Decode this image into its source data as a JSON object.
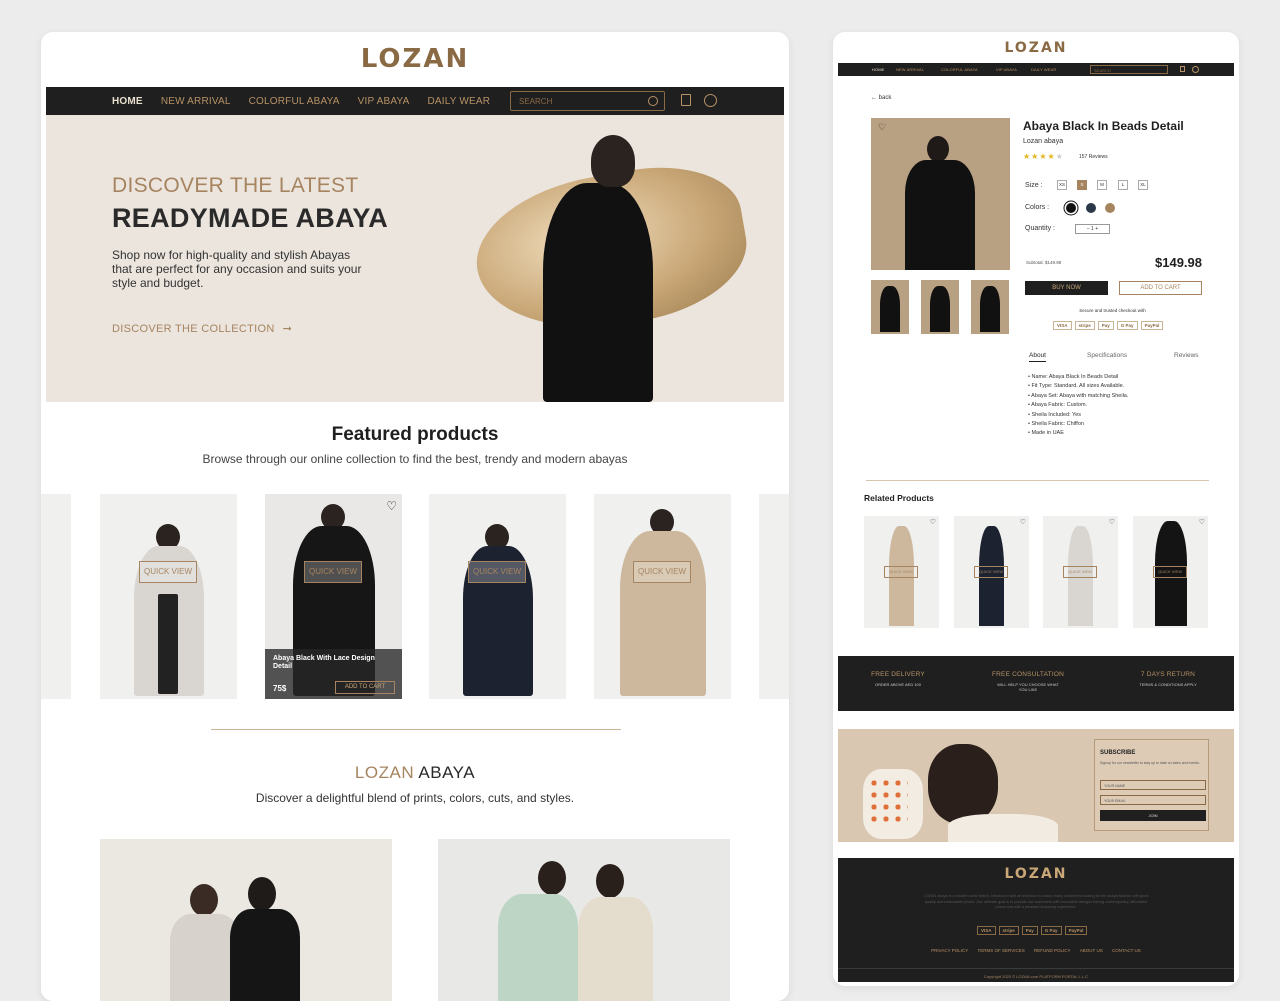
{
  "left": {
    "logo": "LOZAN",
    "nav": [
      "HOME",
      "NEW ARRIVAL",
      "COLORFUL ABAYA",
      "VIP ABAYA",
      "DAILY WEAR"
    ],
    "search_placeholder": "SEARCH",
    "hero": {
      "line1": "DISCOVER THE LATEST",
      "line2": "READYMADE ABAYA",
      "text": "Shop now for high-quality and stylish Abayas that are perfect for any occasion and suits your style and budget.",
      "cta": "DISCOVER THE COLLECTION"
    },
    "featured": {
      "title": "Featured products",
      "subtitle": "Browse through our online collection to find the best, trendy and modern abayas",
      "quick_view": "QUICK VIEW",
      "hover_product": {
        "name": "Abaya Black With Lace Design Detail",
        "price": "75$",
        "add": "ADD TO CART"
      }
    },
    "lozan_abaya": {
      "title_a": "LOZAN",
      "title_b": " ABAYA",
      "subtitle": "Discover a delightful blend of prints, colors, cuts, and styles."
    }
  },
  "right": {
    "logo": "LOZAN",
    "nav": [
      "HOME",
      "NEW ARRIVAL",
      "COLORFUL ABAYA",
      "VIP ABAYA",
      "DAILY WEAR"
    ],
    "search_placeholder": "SEARCH",
    "back": "← back",
    "product": {
      "title": "Abaya Black In Beads Detail",
      "brand": "Lozan abaya",
      "stars_filled": "★★★★",
      "stars_empty": "★",
      "reviews": "157 Reviews",
      "size_label": "Size :",
      "sizes": [
        "XS",
        "S",
        "M",
        "L",
        "XL"
      ],
      "colors_label": "Colors :",
      "colors": [
        "#111111",
        "#2c3848",
        "#a68460"
      ],
      "quantity_label": "Quantity :",
      "quantity": "–   1   +",
      "subtotal": "Subtotal: $149.98",
      "price": "$149.98",
      "buy_now": "BUY NOW",
      "add_to_cart": "ADD TO CART",
      "secure": "Secure and trusted checkout with",
      "payments": [
        "VISA",
        "stripe",
        "Pay",
        "G Pay",
        "PayPal"
      ],
      "tabs": [
        "About",
        "Specifications",
        "Reviews"
      ],
      "specs": [
        "Name: Abaya Black In Beads Detail",
        "Fit Type: Standard. All sizes Available.",
        "Abaya Set: Abaya with matching Sheila.",
        "Abaya Fabric: Custom.",
        "Sheila Included: Yes",
        "Sheila Fabric: Chiffon",
        "Made in UAE"
      ]
    },
    "related_title": "Related Products",
    "quick_view": "QUICK VIEW",
    "features": [
      {
        "title": "FREE DELIVERY",
        "text": "ORDER ABOVE AED 100"
      },
      {
        "title": "FREE CONSULTATION",
        "text": "WILL HELP YOU CHOOSE WHAT YOU LIKE"
      },
      {
        "title": "7 DAYS RETURN",
        "text": "TERMS & CONDITIONS APPLY"
      }
    ],
    "subscribe": {
      "title": "SUBSCRIBE",
      "text": "Signup for our newsletter to stay up to date on sales and events.",
      "name_placeholder": "YOUR NAME",
      "email_placeholder": "YOUR EMAIL",
      "join": "JOIN"
    },
    "footer": {
      "logo": "LOZAN",
      "text": "LOZAN abaya is a modern wear brand, introduced with an intention to match many customers looking for the abaya fashion with good quality and reasonable prices. Our ultimate goal is to provide our customers with innovative designs having contemporary, affordable prices and with a pleasant shopping experience.",
      "links": [
        "PRIVACY POLICY",
        "TERMS OF SERVICES",
        "REFUND POLICY",
        "ABOUT US",
        "CONTACT US"
      ],
      "copyright": "Copyright 2023 © LOZAN.com PLATFORM PORTAL L.L.C"
    }
  }
}
